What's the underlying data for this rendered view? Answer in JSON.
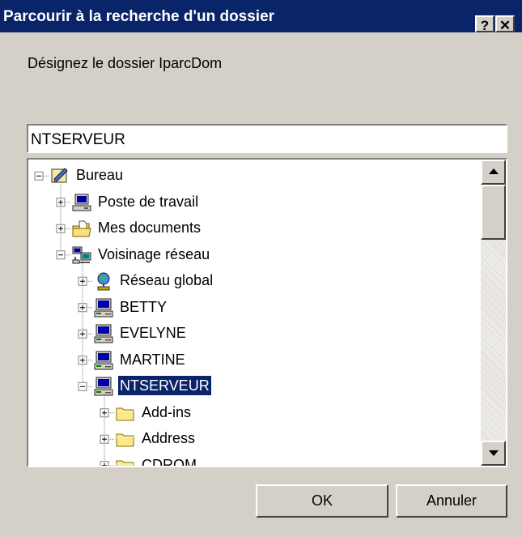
{
  "dialog": {
    "title": "Parcourir à la recherche d'un dossier",
    "help_label": "?",
    "close_label": "✕",
    "prompt": "Désignez le dossier IparcDom",
    "folder_value": "NTSERVEUR",
    "ok_label": "OK",
    "cancel_label": "Annuler"
  },
  "tree": {
    "items": [
      {
        "label": "Bureau",
        "icon": "desktop-icon",
        "level": 0,
        "expander": "minus"
      },
      {
        "label": "Poste de travail",
        "icon": "my-computer-icon",
        "level": 1,
        "expander": "plus"
      },
      {
        "label": "Mes documents",
        "icon": "my-documents-icon",
        "level": 1,
        "expander": "plus"
      },
      {
        "label": "Voisinage réseau",
        "icon": "network-neighborhood-icon",
        "level": 1,
        "expander": "minus"
      },
      {
        "label": "Réseau global",
        "icon": "entire-network-icon",
        "level": 2,
        "expander": "plus"
      },
      {
        "label": "BETTY",
        "icon": "computer-icon",
        "level": 2,
        "expander": "plus"
      },
      {
        "label": "EVELYNE",
        "icon": "computer-icon",
        "level": 2,
        "expander": "plus"
      },
      {
        "label": "MARTINE",
        "icon": "computer-icon",
        "level": 2,
        "expander": "plus"
      },
      {
        "label": "NTSERVEUR",
        "icon": "computer-icon",
        "level": 2,
        "expander": "minus",
        "selected": true
      },
      {
        "label": "Add-ins",
        "icon": "folder-icon",
        "level": 3,
        "expander": "plus"
      },
      {
        "label": "Address",
        "icon": "folder-icon",
        "level": 3,
        "expander": "plus"
      },
      {
        "label": "CDROM",
        "icon": "folder-icon",
        "level": 3,
        "expander": "plus"
      }
    ]
  },
  "colors": {
    "title_bar": "#0a246a",
    "face": "#d4d0c8",
    "selection": "#0a246a"
  }
}
